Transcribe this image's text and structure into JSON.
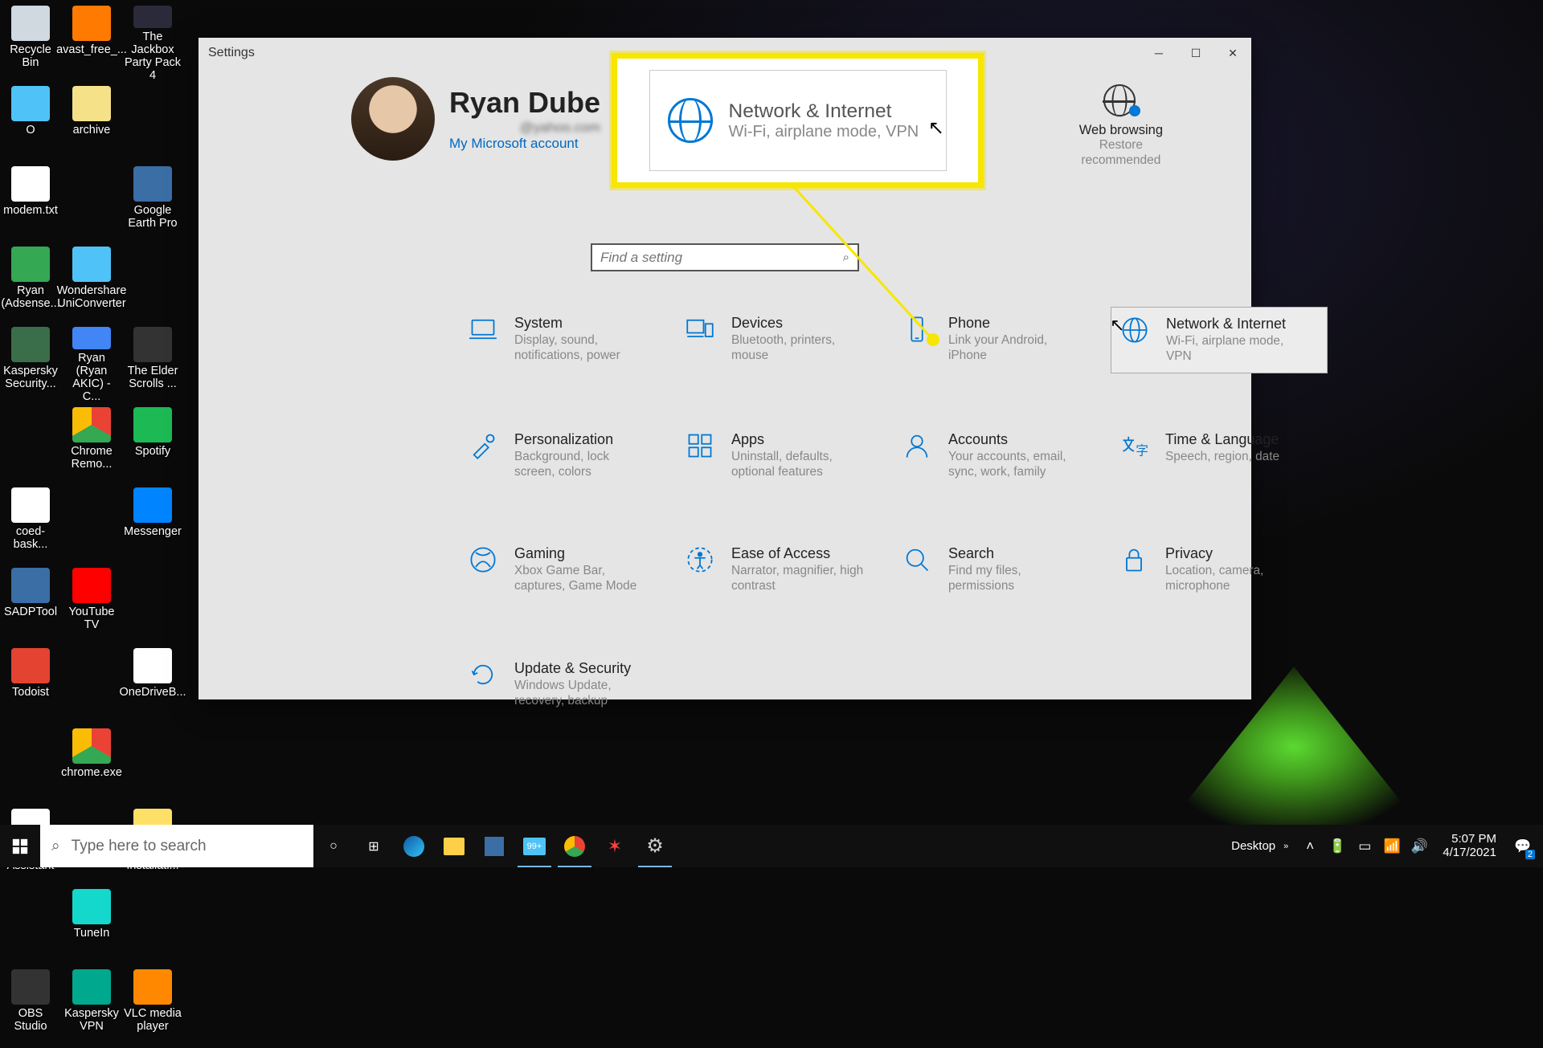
{
  "desktop_icons": [
    {
      "label": "Recycle Bin",
      "color": "#d0d8e0"
    },
    {
      "label": "avast_free_...",
      "color": "#ff7a00"
    },
    {
      "label": "The Jackbox Party Pack 4",
      "color": "#2a2a3a"
    },
    {
      "label": "O",
      "color": "#4fc3f7"
    },
    {
      "label": "archive",
      "color": "#f5e187"
    },
    {
      "label": "",
      "color": "transparent"
    },
    {
      "label": "modem.txt",
      "color": "#ffffff"
    },
    {
      "label": "",
      "color": "transparent"
    },
    {
      "label": "Google Earth Pro",
      "color": "#3a6ea5"
    },
    {
      "label": "Ryan (Adsense...",
      "color": "#34a853"
    },
    {
      "label": "Wondershare UniConverter",
      "color": "#4fc3f7"
    },
    {
      "label": "",
      "color": "transparent"
    },
    {
      "label": "Kaspersky Security...",
      "color": "#3a6e4a"
    },
    {
      "label": "Ryan (Ryan AKIC) - C...",
      "color": "#4285f4"
    },
    {
      "label": "The Elder Scrolls ...",
      "color": "#333"
    },
    {
      "label": "",
      "color": "transparent"
    },
    {
      "label": "Chrome Remo...",
      "color": "linear"
    },
    {
      "label": "Spotify",
      "color": "#1db954"
    },
    {
      "label": "coed-bask...",
      "color": "#ffffff"
    },
    {
      "label": "",
      "color": "transparent"
    },
    {
      "label": "Messenger",
      "color": "#0084ff"
    },
    {
      "label": "SADPTool",
      "color": "#3a6ea5"
    },
    {
      "label": "YouTube TV",
      "color": "#ff0000"
    },
    {
      "label": "",
      "color": "transparent"
    },
    {
      "label": "Todoist",
      "color": "#e44332"
    },
    {
      "label": "",
      "color": "transparent"
    },
    {
      "label": "OneDriveB...",
      "color": "#ffffff"
    },
    {
      "label": "",
      "color": "transparent"
    },
    {
      "label": "chrome.exe",
      "color": "linear"
    },
    {
      "label": "",
      "color": "transparent"
    },
    {
      "label": "Google Assistant",
      "color": "#fff"
    },
    {
      "label": "",
      "color": "transparent"
    },
    {
      "label": "Norton Installati...",
      "color": "#ffe066"
    },
    {
      "label": "",
      "color": "transparent"
    },
    {
      "label": "TuneIn",
      "color": "#14d8cc"
    },
    {
      "label": "",
      "color": "transparent"
    },
    {
      "label": "OBS Studio",
      "color": "#333"
    },
    {
      "label": "Kaspersky VPN",
      "color": "#00a88e"
    },
    {
      "label": "VLC media player",
      "color": "#ff8800"
    }
  ],
  "window": {
    "title": "Settings",
    "user": {
      "name": "Ryan Dube",
      "email": "@yahoo.com",
      "link": "My Microsoft account"
    },
    "webrec": {
      "title": "Web browsing",
      "sub1": "Restore",
      "sub2": "recommended"
    },
    "search_placeholder": "Find a setting",
    "callout": {
      "title": "Network & Internet",
      "sub": "Wi-Fi, airplane mode, VPN"
    },
    "categories": [
      {
        "title": "System",
        "sub": "Display, sound, notifications, power",
        "icon": "laptop"
      },
      {
        "title": "Devices",
        "sub": "Bluetooth, printers, mouse",
        "icon": "devices"
      },
      {
        "title": "Phone",
        "sub": "Link your Android, iPhone",
        "icon": "phone"
      },
      {
        "title": "Network & Internet",
        "sub": "Wi-Fi, airplane mode, VPN",
        "icon": "globe",
        "hover": true
      },
      {
        "title": "Personalization",
        "sub": "Background, lock screen, colors",
        "icon": "brush"
      },
      {
        "title": "Apps",
        "sub": "Uninstall, defaults, optional features",
        "icon": "apps"
      },
      {
        "title": "Accounts",
        "sub": "Your accounts, email, sync, work, family",
        "icon": "person"
      },
      {
        "title": "Time & Language",
        "sub": "Speech, region, date",
        "icon": "lang"
      },
      {
        "title": "Gaming",
        "sub": "Xbox Game Bar, captures, Game Mode",
        "icon": "xbox"
      },
      {
        "title": "Ease of Access",
        "sub": "Narrator, magnifier, high contrast",
        "icon": "access"
      },
      {
        "title": "Search",
        "sub": "Find my files, permissions",
        "icon": "search"
      },
      {
        "title": "Privacy",
        "sub": "Location, camera, microphone",
        "icon": "lock"
      },
      {
        "title": "Update & Security",
        "sub": "Windows Update, recovery, backup",
        "icon": "update"
      }
    ]
  },
  "taskbar": {
    "search_placeholder": "Type here to search",
    "desktop_label": "Desktop",
    "time": "5:07 PM",
    "date": "4/17/2021",
    "badge": "99+",
    "notif": "2"
  }
}
